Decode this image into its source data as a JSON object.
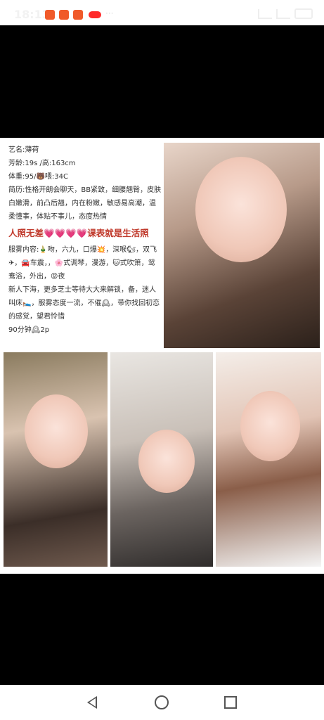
{
  "status_bar": {
    "time": "18:13",
    "notification_icons": [
      "app-notification-icon",
      "app-notification-icon",
      "app-notification-icon",
      "red-badge-icon"
    ],
    "more": "···"
  },
  "profile": {
    "stage_name": "艺名:薄荷",
    "age_height": "芳龄:19s /高:163cm",
    "weight_bust": "体重:95/🐻喂:34C",
    "intro": "简历:性格开朗会聊天，BB紧致，细腰翘臀，皮肤白嫩滑，前凸后翘，内在粉嫩，敏感易高潮，温柔懂事，体贴不事儿，态度热情",
    "slogan": "人照无差💗💗💗💗课表就是生活照",
    "services": "服雾内容:🎍吻，六九，口爆💥，深喉🐿，双飞✈，🚘车震，，🌸式调琴，漫游，🐱式吹箫，鸳鸯浴，外出，😡夜",
    "closing": "新人下海，更多芝士等待大大来解锁，备，迷人叫床🛌，服雾态度一流，不催🕰，带你找回初恋的感觉，望君怜惜",
    "price": "90分钟🕰2p"
  },
  "photos": [
    "main-portrait",
    "portrait-1",
    "portrait-2",
    "portrait-3"
  ],
  "nav": {
    "back": "back-icon",
    "home": "home-icon",
    "recent": "recents-icon"
  }
}
